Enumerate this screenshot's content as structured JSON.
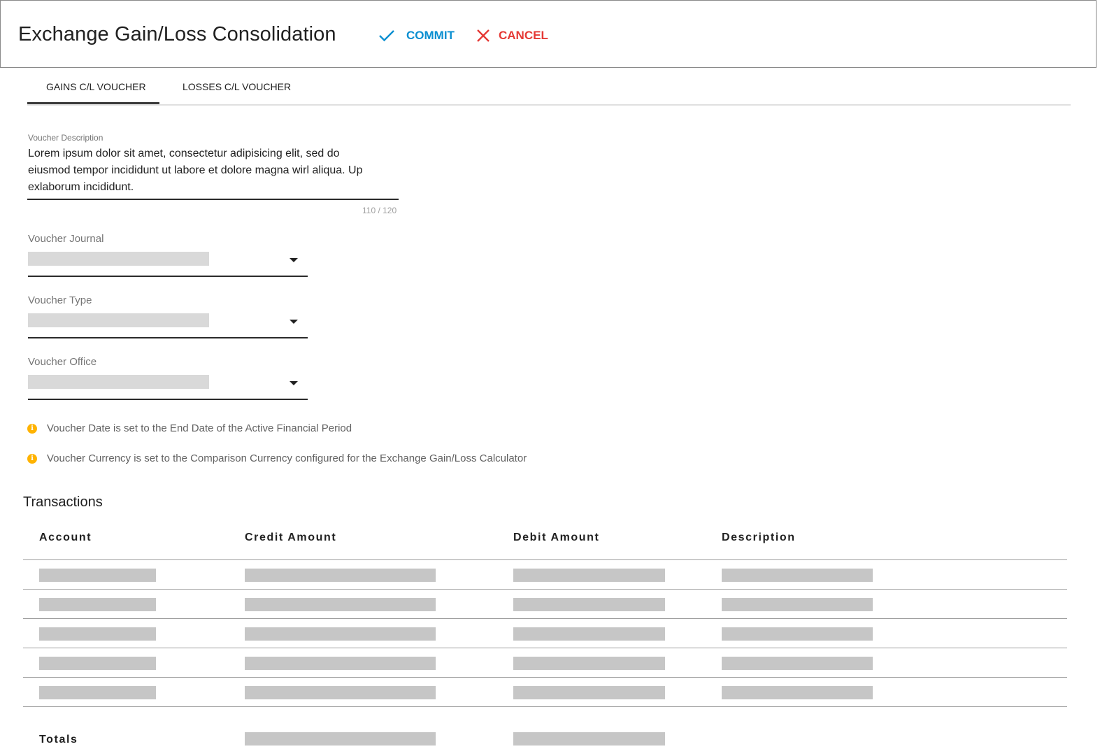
{
  "header": {
    "title": "Exchange Gain/Loss Consolidation",
    "commit_label": "COMMIT",
    "cancel_label": "CANCEL",
    "commit_color": "#0b8fd1",
    "cancel_color": "#e53935"
  },
  "tabs": [
    {
      "label": "GAINS C/L VOUCHER",
      "active": true
    },
    {
      "label": "LOSSES C/L VOUCHER",
      "active": false
    }
  ],
  "form": {
    "description": {
      "label": "Voucher Description",
      "value": "Lorem ipsum dolor sit amet, consectetur adipisicing elit, sed do eiusmod tempor incididunt ut labore et dolore magna wirl aliqua. Up exlaborum incididunt.",
      "counter": "110 / 120"
    },
    "journal": {
      "label": "Voucher Journal",
      "value": ""
    },
    "type": {
      "label": "Voucher Type",
      "value": ""
    },
    "office": {
      "label": "Voucher Office",
      "value": ""
    }
  },
  "info": [
    {
      "icon": "info-icon",
      "text": "Voucher Date is set to the End Date of the Active Financial Period"
    },
    {
      "icon": "info-icon",
      "text": "Voucher Currency is set to the Comparison Currency configured for the Exchange Gain/Loss Calculator"
    }
  ],
  "info_color": "#ffb300",
  "transactions": {
    "title": "Transactions",
    "columns": [
      "Account",
      "Credit Amount",
      "Debit Amount",
      "Description"
    ],
    "row_count": 5,
    "totals_label": "Totals"
  }
}
